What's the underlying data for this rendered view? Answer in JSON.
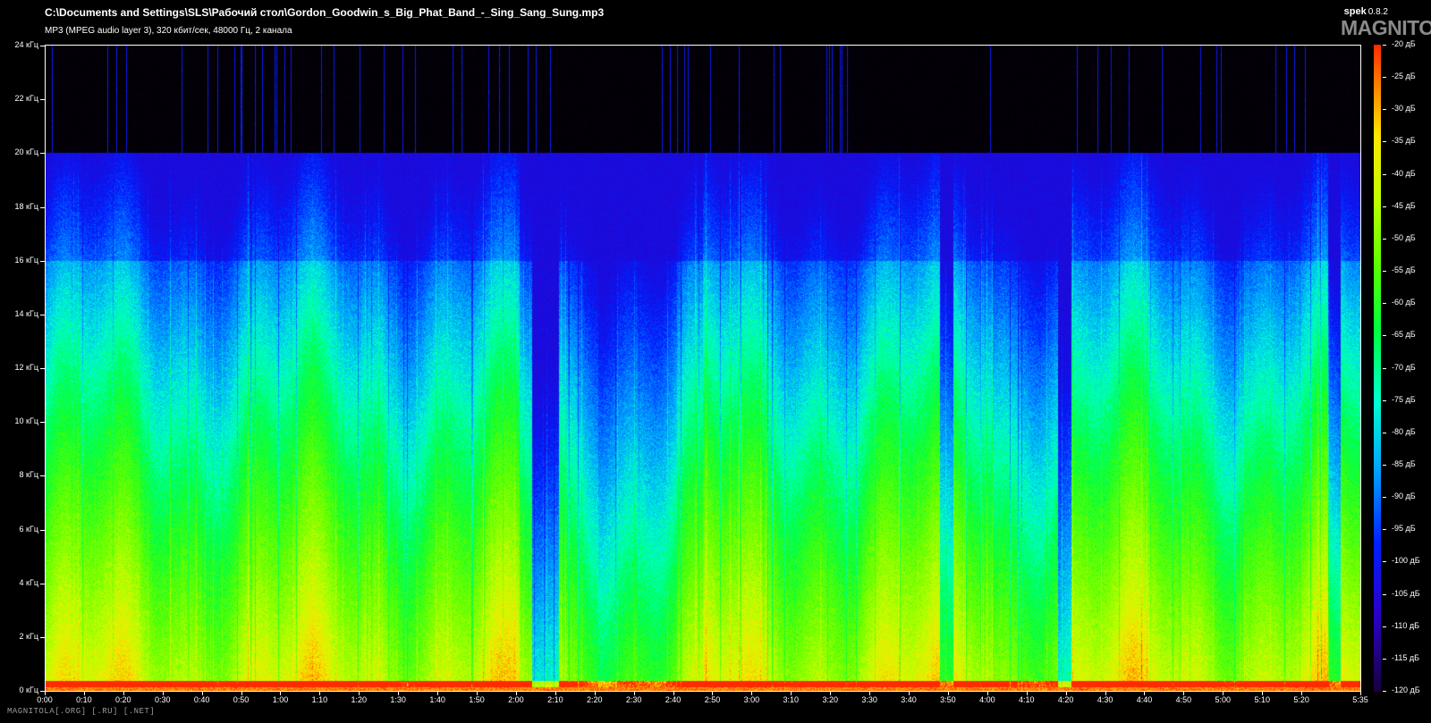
{
  "header": {
    "file_path": "C:\\Documents and Settings\\SLS\\Рабочий стол\\Gordon_Goodwin_s_Big_Phat_Band_-_Sing_Sang_Sung.mp3",
    "file_info": "MP3 (MPEG audio layer 3), 320 кбит/сек, 48000 Гц, 2 канала",
    "app_name": "spek",
    "app_version": "0.8.2"
  },
  "watermark": {
    "logo_text": "MAGNITOLA",
    "footer_text": "MAGNITOLA[.ORG] [.RU] [.NET]"
  },
  "chart_data": {
    "type": "heatmap",
    "description": "spectrogram",
    "y_axis": {
      "min": 0,
      "max": 24,
      "unit": "кГц",
      "ticks": [
        "0 кГц",
        "2 кГц",
        "4 кГц",
        "6 кГц",
        "8 кГц",
        "10 кГц",
        "12 кГц",
        "14 кГц",
        "16 кГц",
        "18 кГц",
        "20 кГц",
        "22 кГц",
        "24 кГц"
      ]
    },
    "x_axis": {
      "min_seconds": 0,
      "max_seconds": 335,
      "ticks": [
        "0:00",
        "0:10",
        "0:20",
        "0:30",
        "0:40",
        "0:50",
        "1:00",
        "1:10",
        "1:20",
        "1:30",
        "1:40",
        "1:50",
        "2:00",
        "2:10",
        "2:20",
        "2:30",
        "2:40",
        "2:50",
        "3:00",
        "3:10",
        "3:20",
        "3:30",
        "3:40",
        "3:50",
        "4:00",
        "4:10",
        "4:20",
        "4:30",
        "4:40",
        "4:50",
        "5:00",
        "5:10",
        "5:20"
      ],
      "end_label": "5:35"
    },
    "colorbar": {
      "min_db": -120,
      "max_db": -20,
      "ticks": [
        "-20 дБ",
        "-25 дБ",
        "-30 дБ",
        "-35 дБ",
        "-40 дБ",
        "-45 дБ",
        "-50 дБ",
        "-55 дБ",
        "-60 дБ",
        "-65 дБ",
        "-70 дБ",
        "-75 дБ",
        "-80 дБ",
        "-85 дБ",
        "-90 дБ",
        "-95 дБ",
        "-100 дБ",
        "-105 дБ",
        "-110 дБ",
        "-115 дБ",
        "-120 дБ"
      ],
      "colors": [
        "#ff2a00",
        "#ff8a00",
        "#ffe600",
        "#bfff00",
        "#5cff00",
        "#00ff3c",
        "#00ffd0",
        "#00a0ff",
        "#0020ff",
        "#2a00c8",
        "#180040"
      ]
    },
    "cutoff_khz": 20
  }
}
